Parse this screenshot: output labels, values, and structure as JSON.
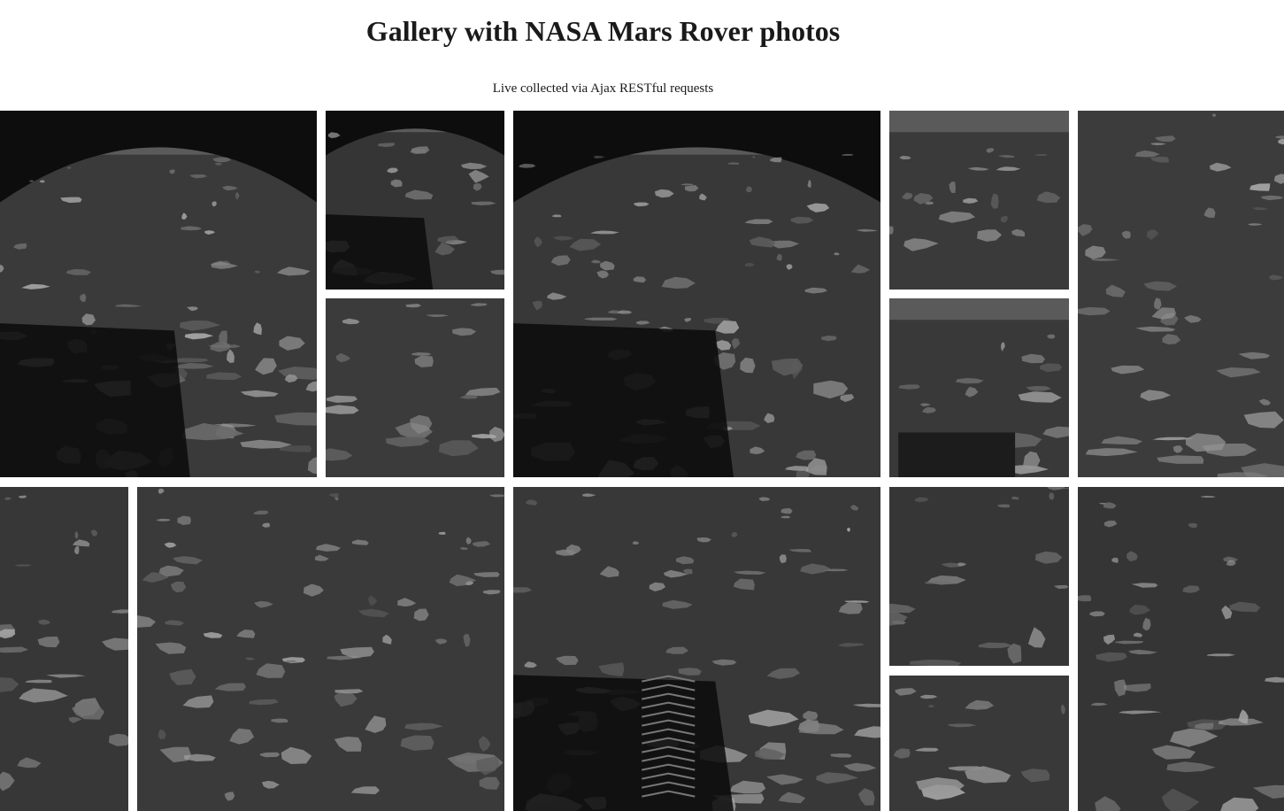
{
  "header": {
    "title": "Gallery with NASA Mars Rover photos",
    "subtitle": "Live collected via Ajax RESTful requests"
  },
  "gallery": {
    "photos": [
      {
        "id": "photo-1",
        "scene": "fisheye-hazcam-rover-shadow",
        "tone": "#3a3a3a"
      },
      {
        "id": "photo-2",
        "scene": "fisheye-wheel-shadow",
        "tone": "#353535"
      },
      {
        "id": "photo-3",
        "scene": "rocky-plain",
        "tone": "#3b3b3b"
      },
      {
        "id": "photo-4",
        "scene": "fisheye-hazcam-wheel",
        "tone": "#383838"
      },
      {
        "id": "photo-5",
        "scene": "rocky-plain-horizon",
        "tone": "#3a3a3a"
      },
      {
        "id": "photo-6",
        "scene": "rocky-plain-rover-deck",
        "tone": "#393939"
      },
      {
        "id": "photo-7",
        "scene": "layered-rocks",
        "tone": "#3c3c3c"
      },
      {
        "id": "photo-8",
        "scene": "rock-outcrop",
        "tone": "#373737"
      },
      {
        "id": "photo-9",
        "scene": "rocky-plain-wide",
        "tone": "#3a3a3a"
      },
      {
        "id": "photo-10",
        "scene": "wheel-tracks-rocks",
        "tone": "#383838"
      },
      {
        "id": "photo-11",
        "scene": "large-boulder",
        "tone": "#363636"
      },
      {
        "id": "photo-12",
        "scene": "pebbles-rocks",
        "tone": "#393939"
      },
      {
        "id": "photo-13",
        "scene": "bright-rock-slab",
        "tone": "#353535"
      }
    ]
  }
}
